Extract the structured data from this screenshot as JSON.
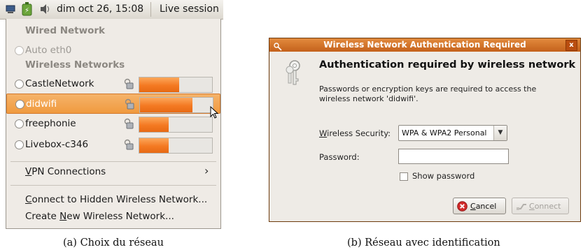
{
  "panel_a": {
    "topbar": {
      "clock": "dim oct 26, 15:08",
      "live_session": "Live session"
    },
    "wired_header": "Wired Network",
    "auto_eth0": "Auto eth0",
    "wireless_header": "Wireless Networks",
    "networks": [
      {
        "name": "CastleNetwork",
        "signal": 0.55
      },
      {
        "name": "didwifi",
        "signal": 0.72
      },
      {
        "name": "freephonie",
        "signal": 0.4
      },
      {
        "name": "Livebox-c346",
        "signal": 0.4
      }
    ],
    "vpn_connections": {
      "underline": "V",
      "rest": "PN Connections"
    },
    "connect_hidden": {
      "underline": "C",
      "rest": "onnect to Hidden Wireless Network..."
    },
    "create_new": {
      "before": "Create ",
      "underline": "N",
      "after": "ew Wireless Network..."
    },
    "caption": "(a) Choix du réseau"
  },
  "panel_b": {
    "title": "Wireless Network Authentication Required",
    "close_symbol": "x",
    "heading": "Authentication required by wireless network",
    "description": "Passwords or encryption keys are required to access the wireless network 'didwifi'.",
    "security_label": {
      "underline": "W",
      "rest": "ireless Security:"
    },
    "security_value": "WPA & WPA2 Personal",
    "password_label": "Password:",
    "password_value": "",
    "show_password": "Show password",
    "cancel": {
      "underline": "C",
      "rest": "ancel"
    },
    "connect": {
      "underline": "C",
      "rest": "onnect"
    },
    "caption": "(b) Réseau avec identification"
  },
  "colors": {
    "accent_orange": "#f47922",
    "title_bar": "#d2772f",
    "menu_bg": "#efebe6",
    "selected_row": "#f09a3f"
  }
}
